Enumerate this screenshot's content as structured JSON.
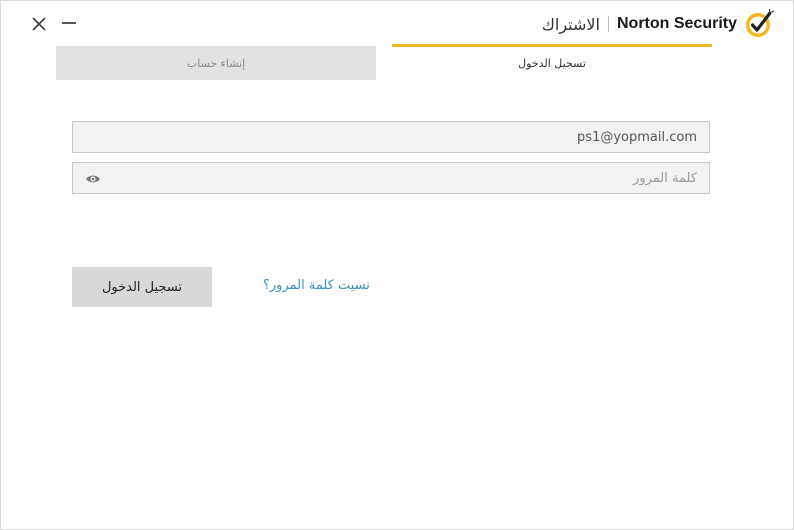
{
  "header": {
    "product_name": "Norton Security",
    "page_subtitle": "الاشتراك",
    "logo_icon": "norton-checkmark-icon",
    "close_icon": "close-icon",
    "minimize_icon": "minimize-icon"
  },
  "tabs": {
    "create_account": "إنشاء حساب",
    "sign_in": "تسجيل الدخول",
    "active": "sign_in"
  },
  "form": {
    "email_value": "ps1@yopmail.com",
    "password_placeholder": "كلمة المرور",
    "eye_icon": "eye-icon",
    "submit_label": "تسجيل الدخول",
    "forgot_password_label": "نسيت كلمة المرور؟"
  },
  "colors": {
    "accent": "#f2b721",
    "link": "#3d8fc2",
    "button_bg": "#d8d8d8"
  }
}
